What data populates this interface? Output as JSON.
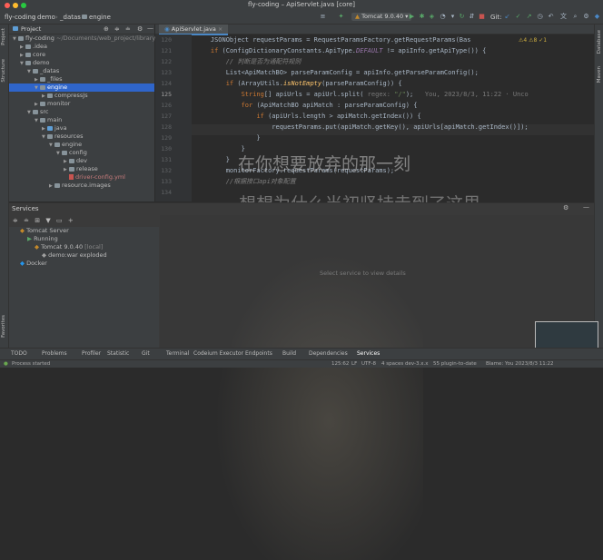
{
  "window": {
    "title": "fly-coding – ApiServlet.java [core]"
  },
  "breadcrumbs": [
    "fly-coding",
    "demo",
    "_datas",
    "engine"
  ],
  "run_config": "Tomcat 9.0.40",
  "git_label": "Git:",
  "project_panel": {
    "title": "Project",
    "tree": [
      {
        "label": "fly-coding",
        "extra": "~/Documents/web_project/library-",
        "indent": 0,
        "kind": "folder",
        "expanded": true
      },
      {
        "label": ".idea",
        "indent": 1,
        "kind": "folder",
        "expanded": false
      },
      {
        "label": "core",
        "indent": 1,
        "kind": "folder",
        "expanded": false
      },
      {
        "label": "demo",
        "indent": 1,
        "kind": "folder",
        "expanded": true
      },
      {
        "label": "_datas",
        "indent": 2,
        "kind": "folder",
        "expanded": true
      },
      {
        "label": "_files",
        "indent": 3,
        "kind": "folder",
        "expanded": false
      },
      {
        "label": "engine",
        "indent": 3,
        "kind": "folder",
        "expanded": true,
        "selected": true
      },
      {
        "label": "compressJs",
        "indent": 4,
        "kind": "folder",
        "expanded": false
      },
      {
        "label": "monitor",
        "indent": 3,
        "kind": "folder",
        "expanded": false
      },
      {
        "label": "src",
        "indent": 2,
        "kind": "folder",
        "expanded": true
      },
      {
        "label": "main",
        "indent": 3,
        "kind": "folder",
        "expanded": true
      },
      {
        "label": "java",
        "indent": 4,
        "kind": "blue",
        "expanded": false
      },
      {
        "label": "resources",
        "indent": 4,
        "kind": "folder",
        "expanded": true
      },
      {
        "label": "engine",
        "indent": 5,
        "kind": "folder",
        "expanded": true
      },
      {
        "label": "config",
        "indent": 6,
        "kind": "folder",
        "expanded": true
      },
      {
        "label": "dev",
        "indent": 7,
        "kind": "folder",
        "expanded": false
      },
      {
        "label": "release",
        "indent": 7,
        "kind": "folder",
        "expanded": false
      },
      {
        "label": "driver-config.yml",
        "indent": 7,
        "kind": "xfile",
        "muted": true
      },
      {
        "label": "resource.images",
        "indent": 5,
        "kind": "folder",
        "expanded": false
      }
    ]
  },
  "editor": {
    "tab": "ApiServlet.java",
    "inspection": "⚠4  ⚠8  ✓1",
    "lines": [
      {
        "n": "120",
        "code": "    JSONObject requestParams = RequestParamsFactory.getRequestParams(Bas"
      },
      {
        "n": "121",
        "code": "    if (ConfigDictionaryConstants.ApiType.DEFAULT != apiInfo.getApiType()) {"
      },
      {
        "n": "122",
        "code": "        // 判断是否为通配符规则"
      },
      {
        "n": "123",
        "code": "        List<ApiMatchBO> parseParamConfig = apiInfo.getParseParamConfig();"
      },
      {
        "n": "124",
        "code": "        if (ArrayUtils.isNotEmpty(parseParamConfig)) {"
      },
      {
        "n": "125",
        "code": "            String[] apiUrls = apiUrl.split( regex: \"/\");   You, 2023/8/3, 11:22 · Unco"
      },
      {
        "n": "126",
        "code": "            for (ApiMatchBO apiMatch : parseParamConfig) {"
      },
      {
        "n": "127",
        "code": "                if (apiUrls.length > apiMatch.getIndex()) {"
      },
      {
        "n": "128",
        "code": "                    requestParams.put(apiMatch.getKey(), apiUrls[apiMatch.getIndex()]);"
      },
      {
        "n": "129",
        "code": "                }"
      },
      {
        "n": "130",
        "code": "            }"
      },
      {
        "n": "131",
        "code": "        }"
      },
      {
        "n": "132",
        "code": "        monitorFactory.requestParams(requestParams);"
      },
      {
        "n": "133",
        "code": "        //根据接口api对象配置"
      },
      {
        "n": "134",
        "code": ""
      }
    ]
  },
  "overlay_text": [
    "在你想要放弃的那一刻",
    "想想为什么当初坚持走到了这里"
  ],
  "services": {
    "title": "Services",
    "tree": [
      {
        "label": "Tomcat Server",
        "indent": 0
      },
      {
        "label": "Running",
        "indent": 1
      },
      {
        "label": "Tomcat 9.0.40",
        "extra": "[local]",
        "indent": 2
      },
      {
        "label": "demo:war exploded",
        "indent": 3
      },
      {
        "label": "Docker",
        "indent": 0
      }
    ],
    "placeholder": "Select service to view details"
  },
  "bottom_tabs": [
    "TODO",
    "Problems",
    "Profiler",
    "Statistic",
    "Git",
    "Terminal",
    "Codeium Executor",
    "Endpoints",
    "Build",
    "Dependencies",
    "Services"
  ],
  "status": {
    "left": "Process started",
    "items": [
      "125:62",
      "LF",
      "UTF-8",
      "4 spaces",
      "dev-3.x.x",
      "55 plugin-to-date",
      "Blame: You 2023/8/3 11:22"
    ]
  }
}
